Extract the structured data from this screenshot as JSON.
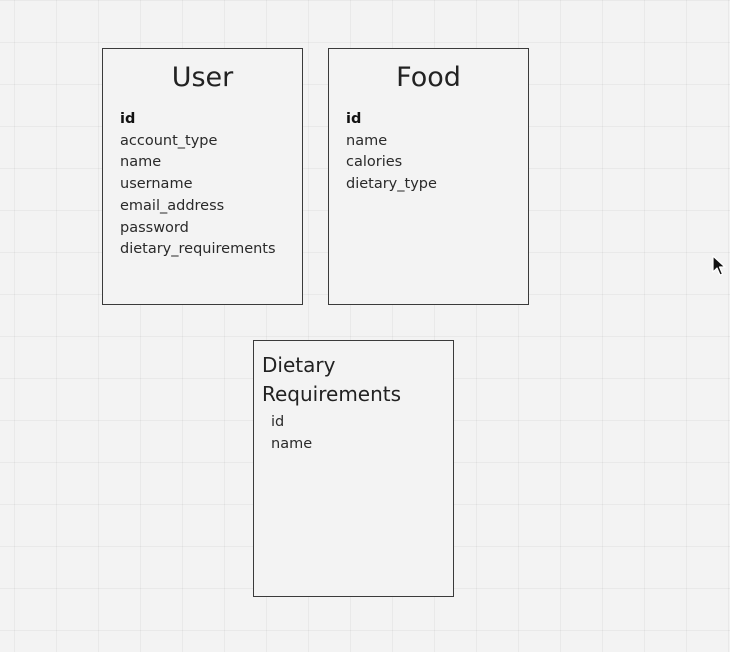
{
  "entities": {
    "user": {
      "title": "User",
      "fields": [
        "id",
        "account_type",
        "name",
        "username",
        "email_address",
        "password",
        "dietary_requirements"
      ]
    },
    "food": {
      "title": "Food",
      "fields": [
        "id",
        "name",
        "calories",
        "dietary_type"
      ]
    },
    "dietary_requirements": {
      "title_line1": "Dietary",
      "title_line2": "Requirements",
      "fields": [
        "id",
        "name"
      ]
    }
  },
  "colors": {
    "background": "#f3f3f3",
    "border": "#3a3a3a",
    "text": "#1f1f1f"
  },
  "icons": {
    "cursor": "mouse-pointer-icon"
  }
}
